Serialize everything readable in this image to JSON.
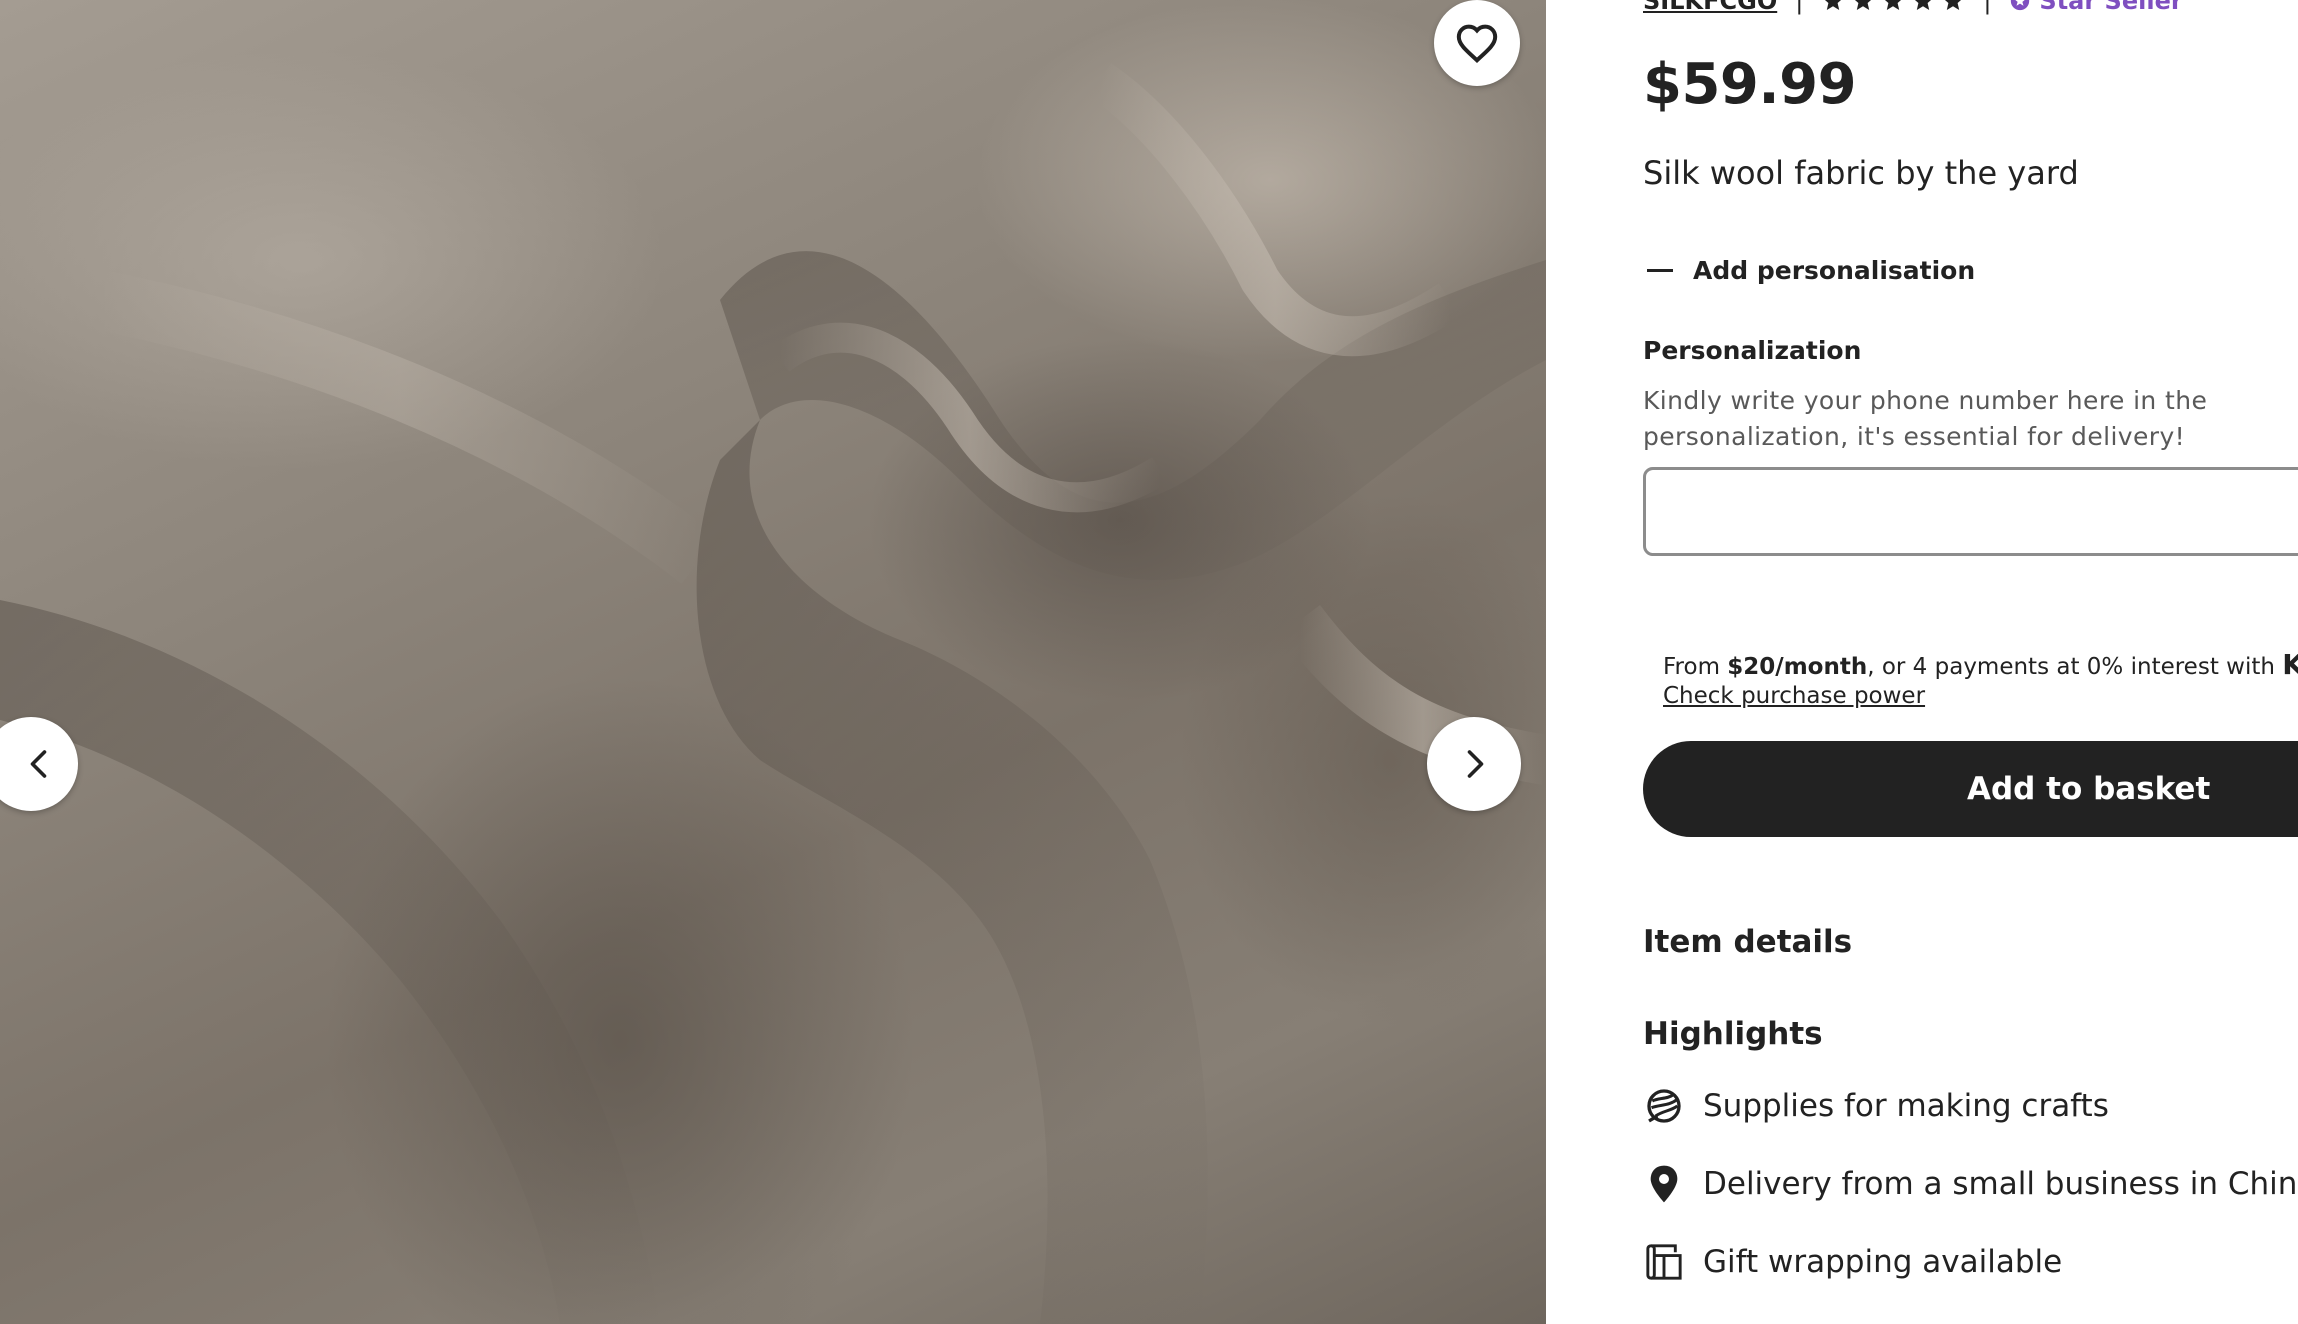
{
  "gallery": {
    "image_alt": "Folded grey-taupe silk wool fabric",
    "favorite_icon": "heart-outline-icon",
    "prev_icon": "chevron-left-icon",
    "next_icon": "chevron-right-icon"
  },
  "shop": {
    "name": "SILKFCGO",
    "rating_stars": 5,
    "star_seller_label": "Star Seller",
    "accent_color": "#7f4fc0"
  },
  "listing": {
    "price": "$59.99",
    "title": "Silk wool fabric by the yard"
  },
  "personalisation": {
    "toggle_label": "Add personalisation",
    "field_label": "Personalization",
    "help_text": "Kindly write your phone number here in the personalization, it's essential for delivery!",
    "input_value": "",
    "input_placeholder": ""
  },
  "klarna": {
    "prefix": "From ",
    "amount": "$20/month",
    "middle": ", or 4 payments at 0% interest with ",
    "brand": "Klarna",
    "link": "Check purchase power"
  },
  "actions": {
    "add_to_basket": "Add to basket",
    "button_color": "#222222"
  },
  "details": {
    "item_details_heading": "Item details",
    "highlights_heading": "Highlights",
    "highlights": [
      {
        "icon": "yarn-ball-icon",
        "text": "Supplies for making crafts"
      },
      {
        "icon": "location-pin-icon",
        "text": "Delivery from a small business in China"
      },
      {
        "icon": "gift-wrap-icon",
        "text": "Gift wrapping available"
      }
    ]
  }
}
